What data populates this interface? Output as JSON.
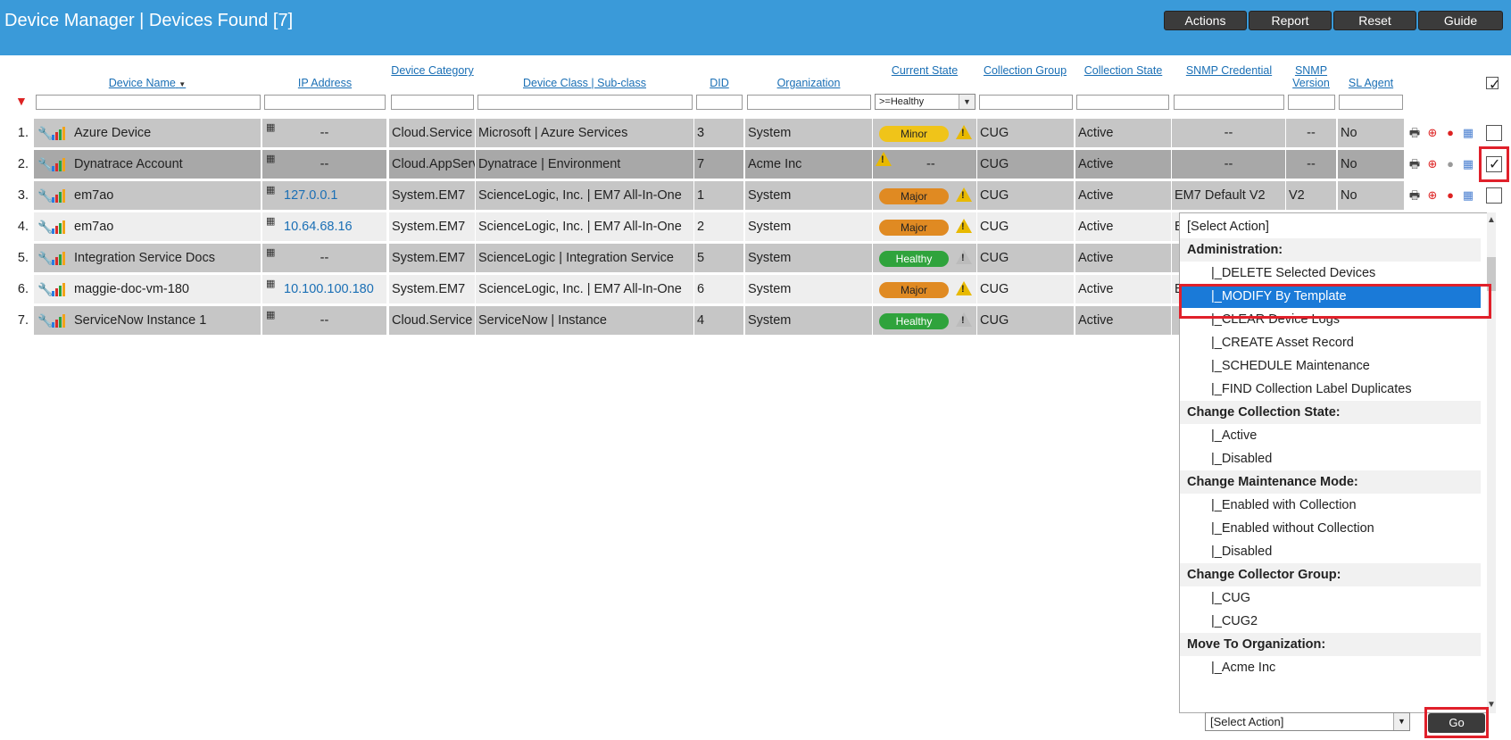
{
  "header": {
    "title": "Device Manager | Devices Found [7]",
    "buttons": [
      "Actions",
      "Report",
      "Reset",
      "Guide"
    ]
  },
  "columns": {
    "device_name": "Device Name",
    "ip_address": "IP Address",
    "device_category": "Device Category",
    "device_class": "Device Class | Sub-class",
    "did": "DID",
    "organization": "Organization",
    "current_state": "Current State",
    "collection_group": "Collection Group",
    "collection_state": "Collection State",
    "snmp_credential": "SNMP Credential",
    "snmp_version": "SNMP Version",
    "sl_agent": "SL Agent",
    "sort_indicator": "▼"
  },
  "filters": {
    "current_state": ">=Healthy"
  },
  "rows": [
    {
      "num": "1.",
      "name": "Azure Device",
      "ip": "--",
      "category": "Cloud.Service",
      "class": "Microsoft | Azure Services",
      "did": "3",
      "org": "System",
      "state": "Minor",
      "group": "CUG",
      "cstate": "Active",
      "snmp_cred": "--",
      "snmp_ver": "--",
      "agent": "No",
      "checked": false
    },
    {
      "num": "2.",
      "name": "Dynatrace Account",
      "ip": "--",
      "category": "Cloud.AppServ",
      "class": "Dynatrace | Environment",
      "did": "7",
      "org": "Acme Inc",
      "state": "--",
      "group": "CUG",
      "cstate": "Active",
      "snmp_cred": "--",
      "snmp_ver": "--",
      "agent": "No",
      "checked": true
    },
    {
      "num": "3.",
      "name": "em7ao",
      "ip": "127.0.0.1",
      "category": "System.EM7",
      "class": "ScienceLogic, Inc. | EM7 All-In-One",
      "did": "1",
      "org": "System",
      "state": "Major",
      "group": "CUG",
      "cstate": "Active",
      "snmp_cred": "EM7 Default V2",
      "snmp_ver": "V2",
      "agent": "No",
      "checked": false
    },
    {
      "num": "4.",
      "name": "em7ao",
      "ip": "10.64.68.16",
      "category": "System.EM7",
      "class": "ScienceLogic, Inc. | EM7 All-In-One",
      "did": "2",
      "org": "System",
      "state": "Major",
      "group": "CUG",
      "cstate": "Active",
      "snmp_cred": "E",
      "snmp_ver": "",
      "agent": "",
      "checked": false
    },
    {
      "num": "5.",
      "name": "Integration Service Docs",
      "ip": "--",
      "category": "System.EM7",
      "class": "ScienceLogic | Integration Service",
      "did": "5",
      "org": "System",
      "state": "Healthy",
      "group": "CUG",
      "cstate": "Active",
      "snmp_cred": "",
      "snmp_ver": "",
      "agent": "",
      "checked": false
    },
    {
      "num": "6.",
      "name": "maggie-doc-vm-180",
      "ip": "10.100.100.180",
      "category": "System.EM7",
      "class": "ScienceLogic, Inc. | EM7 All-In-One",
      "did": "6",
      "org": "System",
      "state": "Major",
      "group": "CUG",
      "cstate": "Active",
      "snmp_cred": "E",
      "snmp_ver": "",
      "agent": "",
      "checked": false
    },
    {
      "num": "7.",
      "name": "ServiceNow Instance 1",
      "ip": "--",
      "category": "Cloud.Service",
      "class": "ServiceNow | Instance",
      "did": "4",
      "org": "System",
      "state": "Healthy",
      "group": "CUG",
      "cstate": "Active",
      "snmp_cred": "",
      "snmp_ver": "",
      "agent": "",
      "checked": false
    }
  ],
  "dropdown": {
    "items": [
      {
        "label": "[Select Action]",
        "type": "plain"
      },
      {
        "label": "Administration:",
        "type": "group"
      },
      {
        "label": "|_DELETE Selected Devices",
        "type": "opt"
      },
      {
        "label": "|_MODIFY By Template",
        "type": "opt",
        "selected": true
      },
      {
        "label": "|_CLEAR Device Logs",
        "type": "opt"
      },
      {
        "label": "|_CREATE Asset Record",
        "type": "opt"
      },
      {
        "label": "|_SCHEDULE Maintenance",
        "type": "opt"
      },
      {
        "label": "|_FIND Collection Label Duplicates",
        "type": "opt"
      },
      {
        "label": "Change Collection State:",
        "type": "group"
      },
      {
        "label": "|_Active",
        "type": "opt"
      },
      {
        "label": "|_Disabled",
        "type": "opt"
      },
      {
        "label": "Change Maintenance Mode:",
        "type": "group"
      },
      {
        "label": "|_Enabled with Collection",
        "type": "opt"
      },
      {
        "label": "|_Enabled without Collection",
        "type": "opt"
      },
      {
        "label": "|_Disabled",
        "type": "opt"
      },
      {
        "label": "Change Collector Group:",
        "type": "group"
      },
      {
        "label": "|_CUG",
        "type": "opt"
      },
      {
        "label": "|_CUG2",
        "type": "opt"
      },
      {
        "label": "Move To Organization:",
        "type": "group"
      },
      {
        "label": "|_Acme Inc",
        "type": "opt"
      }
    ]
  },
  "footer": {
    "select_value": "[Select Action]",
    "go_label": "Go"
  },
  "colors": {
    "header_bg": "#3a9ad9",
    "link": "#1a6fb5",
    "highlight": "#e0202a",
    "minor": "#f0c419",
    "major": "#e08a22",
    "healthy": "#2fa33c"
  }
}
